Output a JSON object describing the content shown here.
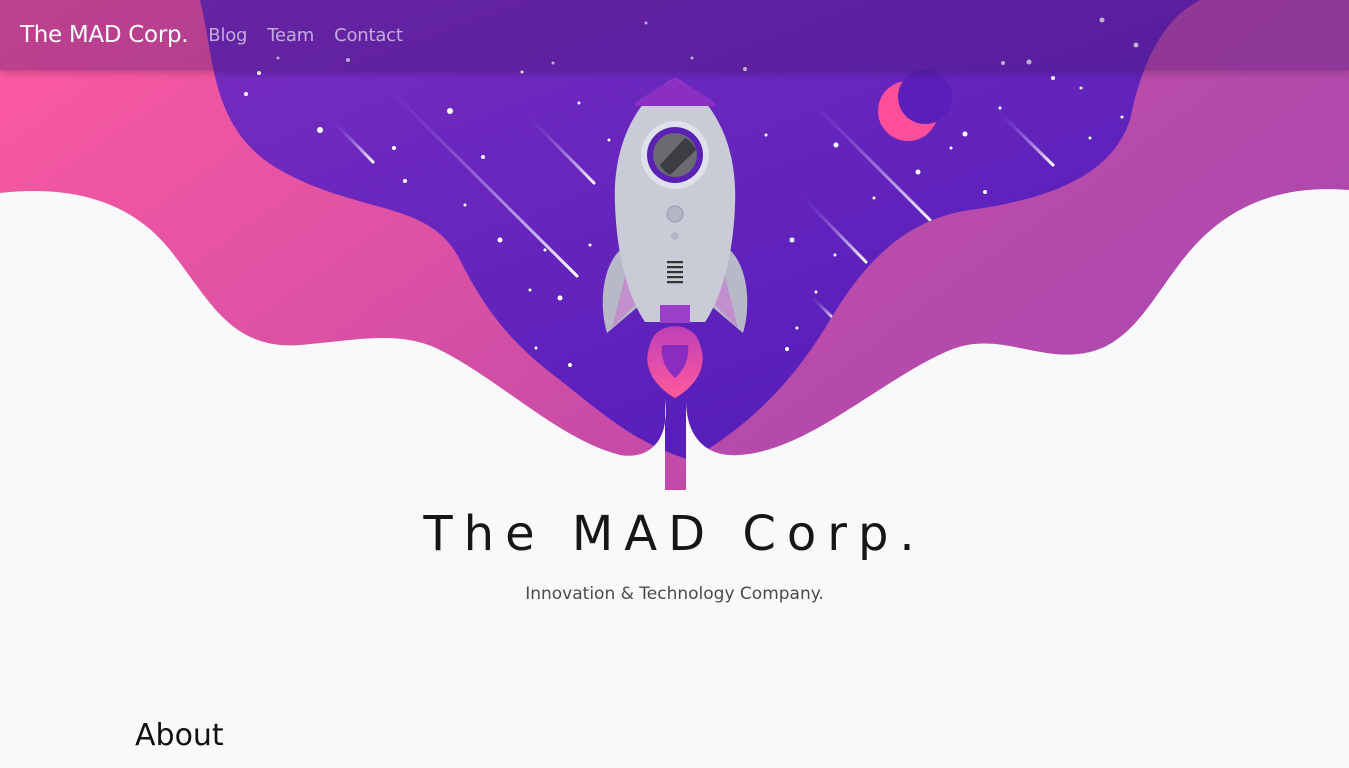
{
  "navbar": {
    "brand": "The MAD Corp.",
    "links": [
      {
        "label": "Blog"
      },
      {
        "label": "Team"
      },
      {
        "label": "Contact"
      }
    ]
  },
  "hero": {
    "title": "The MAD Corp.",
    "subtitle": "Innovation & Technology Company."
  },
  "sections": {
    "about_heading": "About"
  },
  "colors": {
    "space_purple": "#5b1fb0",
    "wave_pink": "#f0559d",
    "wave_magenta": "#b44aa8",
    "moon_pink": "#ff4f9a",
    "rocket_body": "#c9ccd6",
    "page_bg": "#f8f9fb"
  }
}
